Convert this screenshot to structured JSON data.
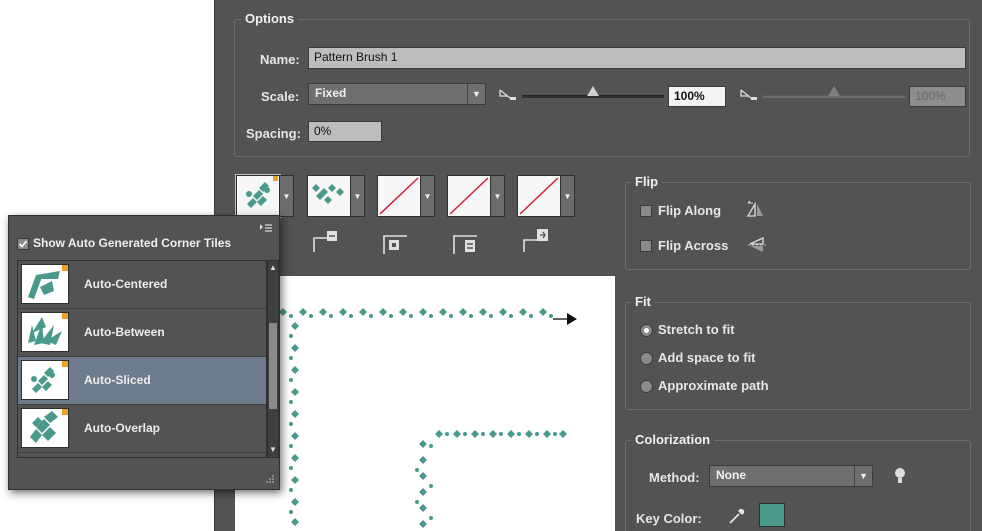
{
  "options": {
    "title": "Options",
    "name_label": "Name:",
    "name_value": "Pattern Brush 1",
    "scale_label": "Scale:",
    "scale_value": "Fixed",
    "scale_percent": "100%",
    "scale_percent_2": "100%",
    "spacing_label": "Spacing:",
    "spacing_value": "0%"
  },
  "flip": {
    "title": "Flip",
    "along": "Flip Along",
    "across": "Flip Across"
  },
  "fit": {
    "title": "Fit",
    "stretch": "Stretch to fit",
    "add_space": "Add space to fit",
    "approximate": "Approximate path"
  },
  "colorization": {
    "title": "Colorization",
    "method_label": "Method:",
    "method_value": "None",
    "key_color_label": "Key Color:",
    "key_color": "#4a9a8c"
  },
  "popup": {
    "show_auto_label": "Show Auto Generated Corner Tiles",
    "items": [
      {
        "label": "Auto-Centered"
      },
      {
        "label": "Auto-Between"
      },
      {
        "label": "Auto-Sliced"
      },
      {
        "label": "Auto-Overlap"
      }
    ]
  },
  "colors": {
    "pattern": "#4a9a8c",
    "panel": "#535353",
    "selection": "#6d7b8c",
    "accent": "#f0a020",
    "none_slash": "#d0203a"
  }
}
